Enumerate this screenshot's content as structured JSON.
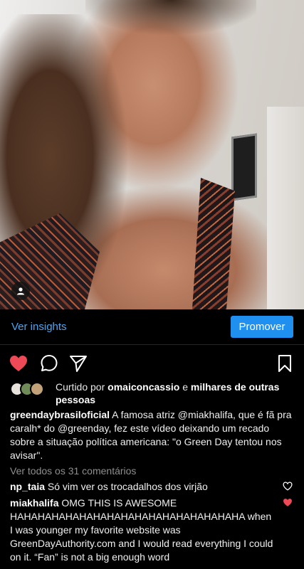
{
  "insights": {
    "link_label": "Ver insights",
    "promote_label": "Promover"
  },
  "colors": {
    "accent": "#1f8ff0",
    "link": "#4aa6f3",
    "like_red": "#ed4956",
    "muted": "#8e8e8e"
  },
  "actions": {
    "like_icon": "heart-filled-icon",
    "comment_icon": "comment-icon",
    "share_icon": "send-icon",
    "save_icon": "bookmark-icon"
  },
  "likes": {
    "prefix": "Curtido por",
    "user": "omaiconcassio",
    "connector": "e",
    "others": "milhares de outras pessoas"
  },
  "caption": {
    "author": "greendaybrasiloficial",
    "text_1": " A famosa atriz ",
    "mention_1": "@miakhalifa",
    "text_2": ", que é fã pra caralh* do ",
    "mention_2": "@greenday",
    "text_3": ", fez este vídeo deixando um recado sobre a situação política americana: \"o Green Day tentou nos avisar\"."
  },
  "view_comments": "Ver todos os 31 comentários",
  "comments": [
    {
      "user": "np_taia",
      "text": "Só vim ver os trocadalhos dos virjão",
      "liked": false
    },
    {
      "user": "miakhalifa",
      "text": "OMG THIS IS AWESOME HAHAHAHAHAHAHAHAHAHAHAHAHAHAHAHAHA when I was younger my favorite website was GreenDayAuthority.com and I would read everything I could on it. “Fan” is not a big enough word",
      "liked": true
    }
  ]
}
